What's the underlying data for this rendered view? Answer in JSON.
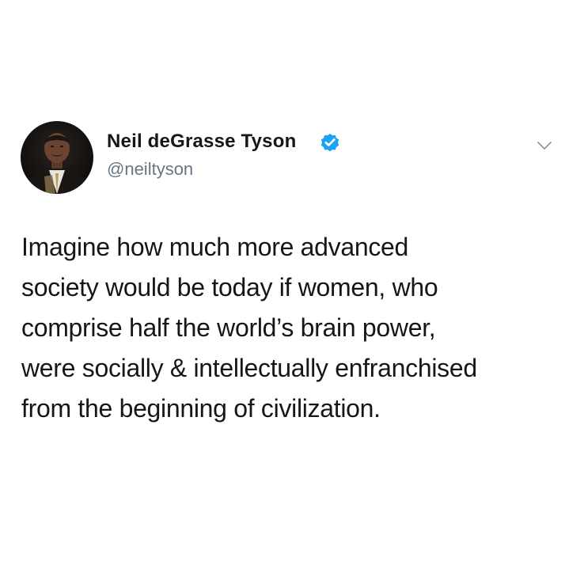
{
  "tweet": {
    "author": {
      "name": "Neil deGrasse Tyson",
      "handle": "@neiltyson",
      "verified": true,
      "avatar_icon": "profile-photo"
    },
    "menu_icon": "chevron-down-icon",
    "text_lines": [
      "Imagine how much more advanced",
      "society would be today if women, who",
      "comprise half the world’s brain power,",
      "were socially & intellectually enfranchised",
      "from the beginning of civilization."
    ]
  },
  "colors": {
    "text": "#14171a",
    "secondary": "#657786",
    "verified": "#1da1f2",
    "background": "#ffffff"
  }
}
